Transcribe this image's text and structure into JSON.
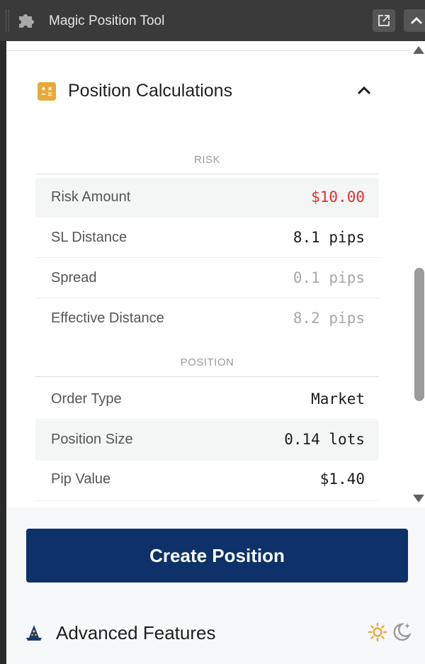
{
  "window": {
    "title": "Magic Position Tool"
  },
  "section": {
    "title": "Position Calculations"
  },
  "groups": {
    "risk": "RISK",
    "position": "POSITION"
  },
  "rows": {
    "risk_amount": {
      "label": "Risk Amount",
      "value": "$10.00"
    },
    "sl_distance": {
      "label": "SL Distance",
      "value": "8.1 pips"
    },
    "spread": {
      "label": "Spread",
      "value": "0.1 pips"
    },
    "effective_distance": {
      "label": "Effective Distance",
      "value": "8.2 pips"
    },
    "order_type": {
      "label": "Order Type",
      "value": "Market"
    },
    "position_size": {
      "label": "Position Size",
      "value": "0.14 lots"
    },
    "pip_value": {
      "label": "Pip Value",
      "value": "$1.40"
    }
  },
  "actions": {
    "create_position": "Create Position"
  },
  "advanced": {
    "label": "Advanced Features"
  },
  "colors": {
    "accent_navy": "#0d3168",
    "risk_red": "#e03131",
    "icon_amber": "#e6a93a"
  }
}
